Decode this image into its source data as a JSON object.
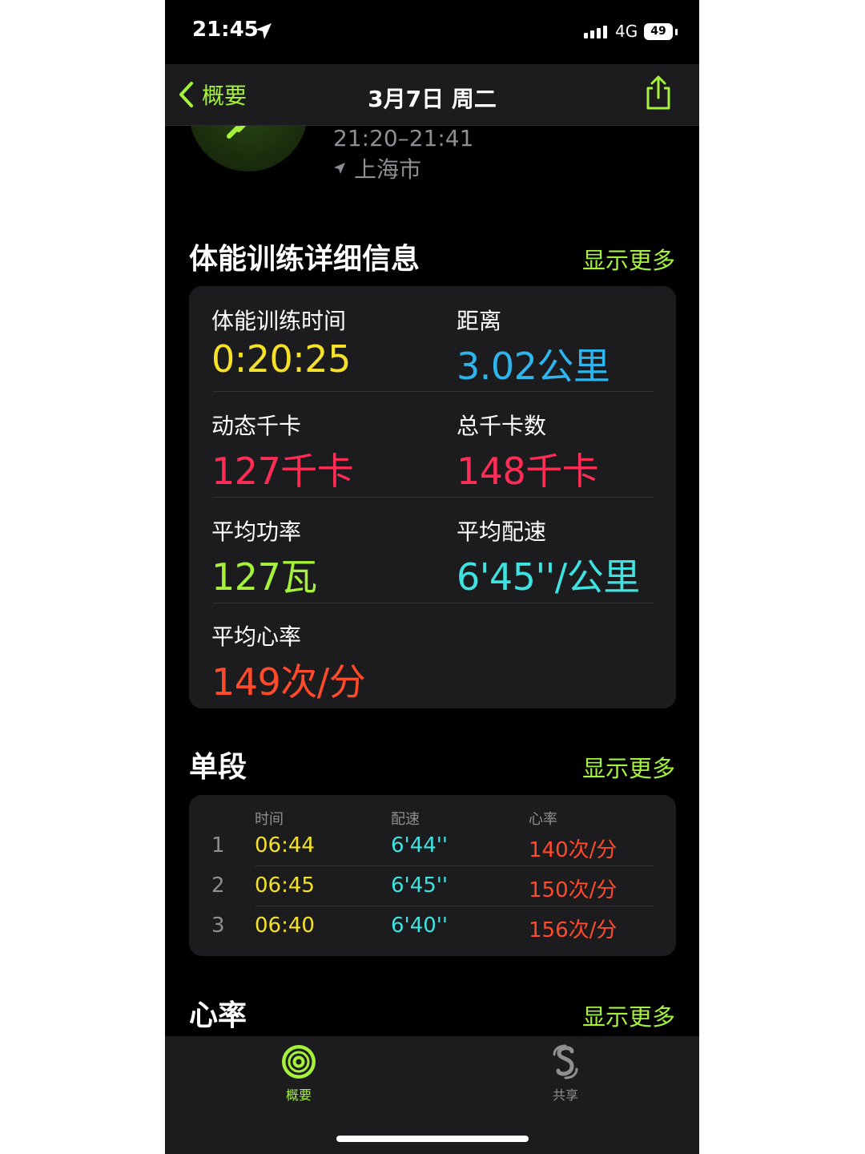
{
  "status_bar": {
    "time": "21:45",
    "network": "4G",
    "battery": "49"
  },
  "nav": {
    "back_label": "概要",
    "title": "3月7日 周二"
  },
  "workout": {
    "time_range": "21:20–21:41",
    "location": "上海市"
  },
  "details": {
    "title": "体能训练详细信息",
    "show_more": "显示更多",
    "metrics": [
      {
        "label": "体能训练时间",
        "value": "0:20:25",
        "color": "#f5e228"
      },
      {
        "label": "距离",
        "value": "3.02公里",
        "color": "#2fb5ee"
      },
      {
        "label": "动态千卡",
        "value": "127千卡",
        "color": "#ff2d55"
      },
      {
        "label": "总千卡数",
        "value": "148千卡",
        "color": "#ff2d55"
      },
      {
        "label": "平均功率",
        "value": "127瓦",
        "color": "#a6f23a"
      },
      {
        "label": "平均配速",
        "value": "6'45''/公里",
        "color": "#3ee2e0"
      },
      {
        "label": "平均心率",
        "value": "149次/分",
        "color": "#ff4b2b"
      }
    ]
  },
  "splits": {
    "title": "单段",
    "show_more": "显示更多",
    "headers": [
      "时间",
      "配速",
      "心率"
    ],
    "rows": [
      {
        "num": "1",
        "time": "06:44",
        "pace": "6'44''",
        "hr": "140次/分"
      },
      {
        "num": "2",
        "time": "06:45",
        "pace": "6'45''",
        "hr": "150次/分"
      },
      {
        "num": "3",
        "time": "06:40",
        "pace": "6'40''",
        "hr": "156次/分"
      }
    ]
  },
  "heart_rate": {
    "title": "心率",
    "show_more": "显示更多"
  },
  "tabs": [
    {
      "label": "概要",
      "icon": "activity-rings-icon",
      "active": true
    },
    {
      "label": "共享",
      "icon": "sharing-icon",
      "active": false
    }
  ],
  "colors": {
    "accent": "#a6f23a",
    "background": "#000000",
    "card": "#1c1c1e"
  }
}
